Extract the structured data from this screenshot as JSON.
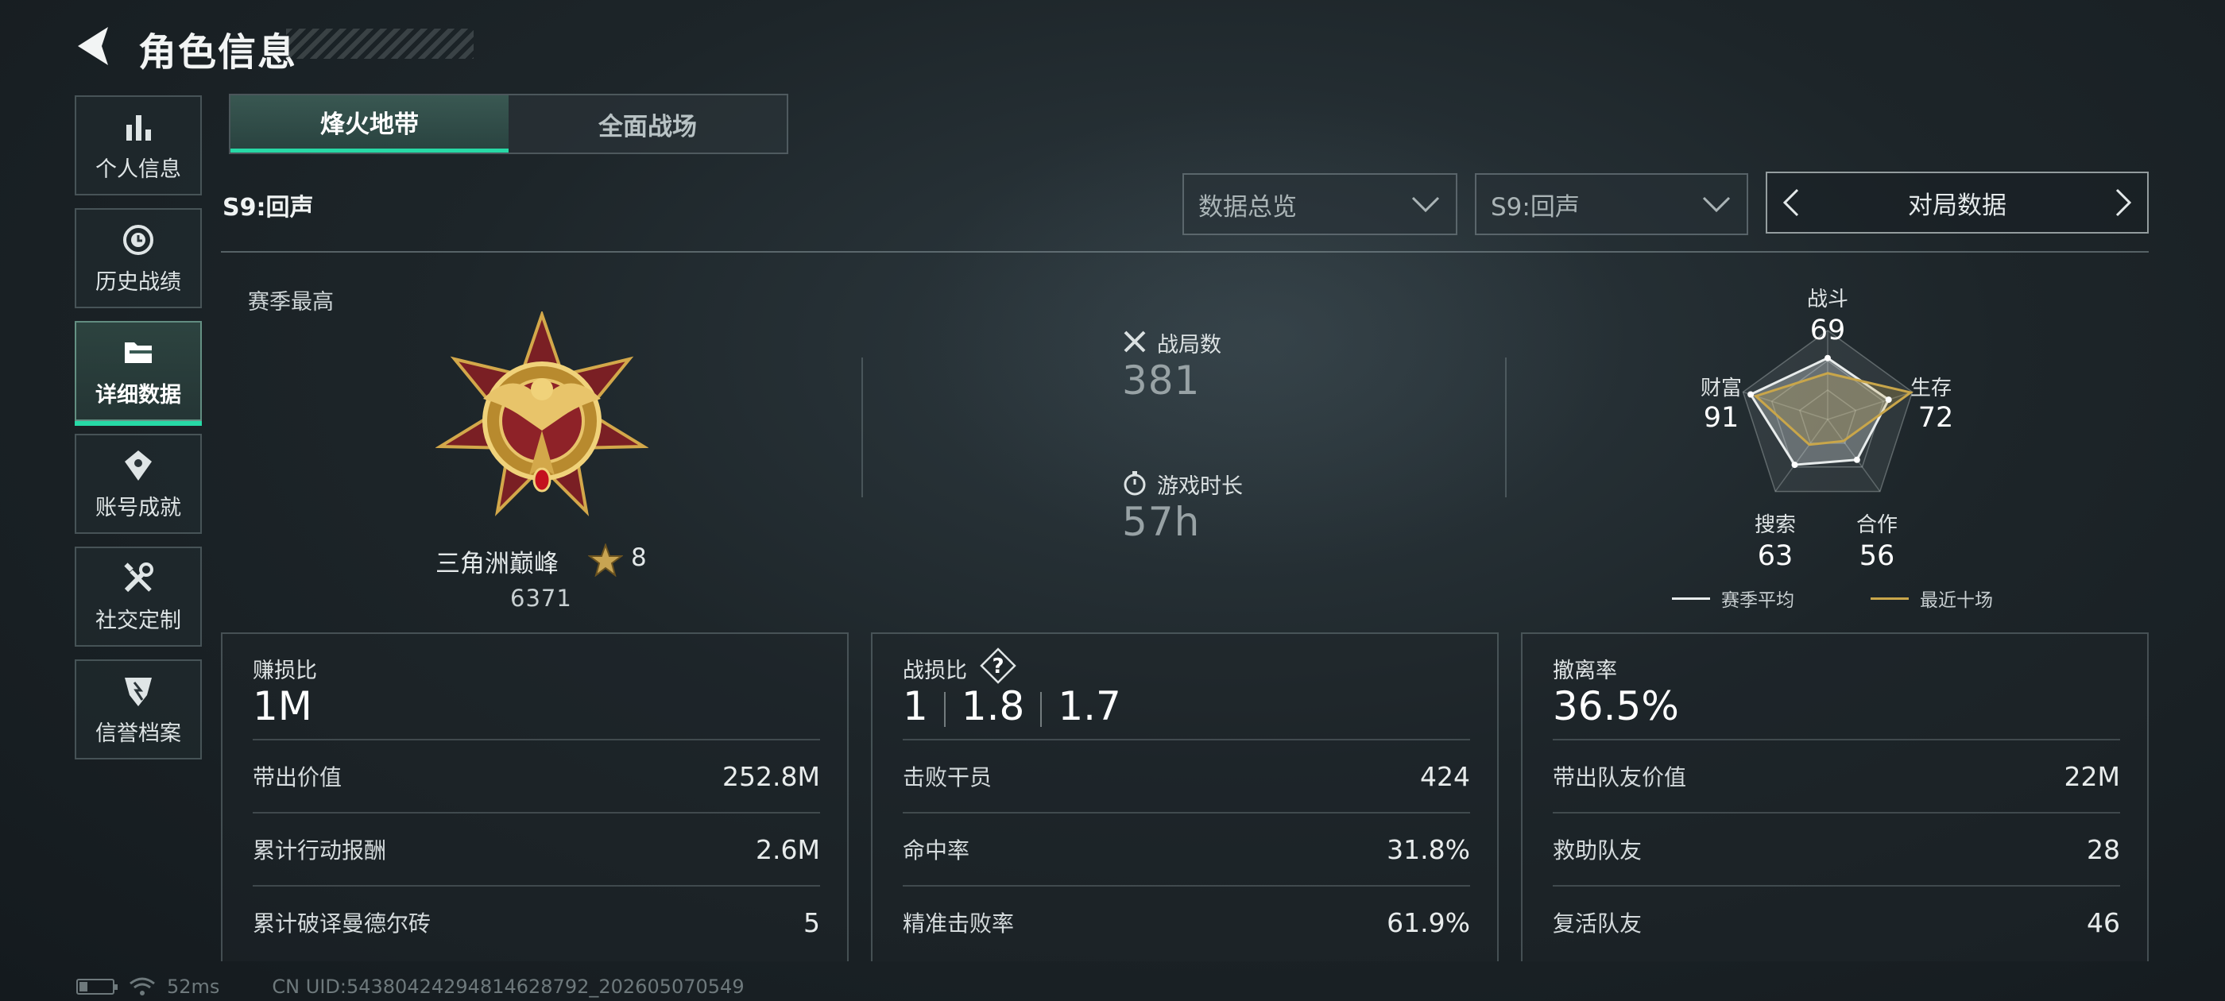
{
  "header": {
    "title": "角色信息"
  },
  "sidebar": {
    "items": [
      {
        "label": "个人信息",
        "icon": "bar-chart-icon",
        "active": false
      },
      {
        "label": "历史战绩",
        "icon": "history-icon",
        "active": false
      },
      {
        "label": "详细数据",
        "icon": "folder-icon",
        "active": true
      },
      {
        "label": "账号成就",
        "icon": "achievement-icon",
        "active": false
      },
      {
        "label": "社交定制",
        "icon": "tools-icon",
        "active": false
      },
      {
        "label": "信誉档案",
        "icon": "credit-shield-icon",
        "active": false
      }
    ]
  },
  "tabs": [
    {
      "label": "烽火地带",
      "active": true
    },
    {
      "label": "全面战场",
      "active": false
    }
  ],
  "season_label": "S9:回声",
  "filters": {
    "data_scope": "数据总览",
    "season": "S9:回声",
    "match_nav_label": "对局数据"
  },
  "season_best": {
    "label": "赛季最高",
    "rank_name": "三角洲巅峰",
    "stars": "8",
    "score": "6371"
  },
  "summary": {
    "matches_label": "战局数",
    "matches_value": "381",
    "playtime_label": "游戏时长",
    "playtime_value": "57h"
  },
  "radar": {
    "axes": [
      {
        "label": "战斗",
        "value": "69"
      },
      {
        "label": "生存",
        "value": "72"
      },
      {
        "label": "合作",
        "value": "56"
      },
      {
        "label": "搜索",
        "value": "63"
      },
      {
        "label": "财富",
        "value": "91"
      }
    ],
    "recent": [
      0.52,
      0.98,
      0.3,
      0.35,
      0.85
    ],
    "legend": {
      "season_avg": "赛季平均",
      "recent_ten": "最近十场"
    },
    "colors": {
      "season_avg": "#e8ecec",
      "recent_ten": "#c9a64a"
    }
  },
  "panels": [
    {
      "title": "赚损比",
      "big": "1M",
      "rows": [
        {
          "label": "带出价值",
          "value": "252.8M"
        },
        {
          "label": "累计行动报酬",
          "value": "2.6M"
        },
        {
          "label": "累计破译曼德尔砖",
          "value": "5"
        }
      ]
    },
    {
      "title": "战损比",
      "big_parts": [
        "1",
        "1.8",
        "1.7"
      ],
      "rows": [
        {
          "label": "击败干员",
          "value": "424"
        },
        {
          "label": "命中率",
          "value": "31.8%"
        },
        {
          "label": "精准击败率",
          "value": "61.9%"
        }
      ]
    },
    {
      "title": "撤离率",
      "big": "36.5%",
      "rows": [
        {
          "label": "带出队友价值",
          "value": "22M"
        },
        {
          "label": "救助队友",
          "value": "28"
        },
        {
          "label": "复活队友",
          "value": "46"
        }
      ]
    }
  ],
  "footer": {
    "ping": "52ms",
    "uid": "CN UID:5438042429481462879​2_202605070549"
  },
  "accent": "#27d9a6"
}
